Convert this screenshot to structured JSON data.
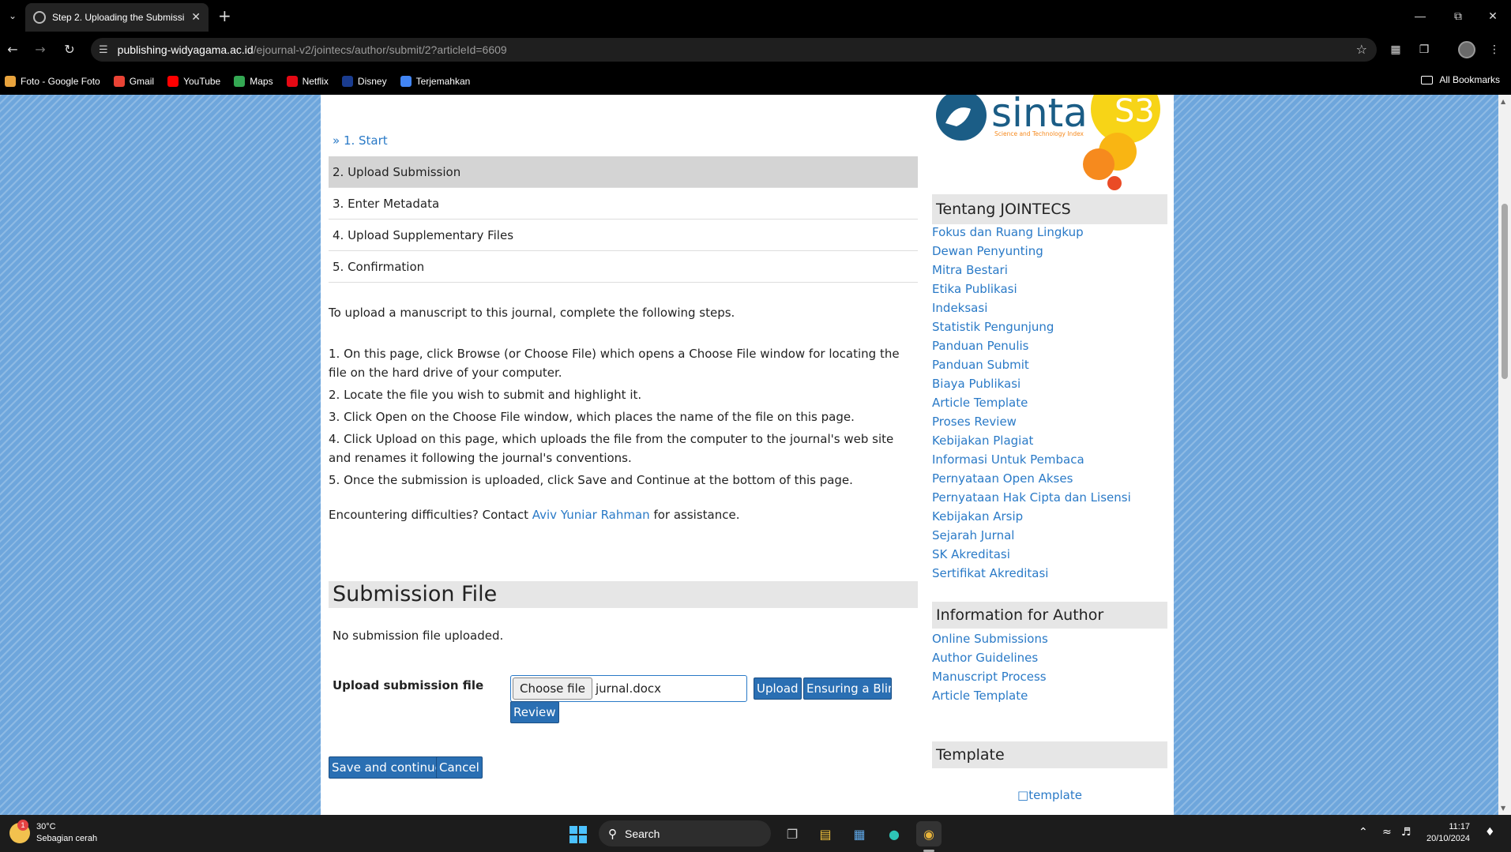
{
  "browser": {
    "tab_title": "Step 2. Uploading the Submissi",
    "url_host": "publishing-widyagama.ac.id",
    "url_path": "/ejournal-v2/jointecs/author/submit/2?articleId=6609",
    "bookmarks": [
      {
        "label": "Foto - Google Foto",
        "icon": "google-photos-icon",
        "color": "#e8a33d"
      },
      {
        "label": "Gmail",
        "icon": "gmail-icon",
        "color": "#ea4335"
      },
      {
        "label": "YouTube",
        "icon": "youtube-icon",
        "color": "#ff0000"
      },
      {
        "label": "Maps",
        "icon": "maps-icon",
        "color": "#34a853"
      },
      {
        "label": "Netflix",
        "icon": "netflix-icon",
        "color": "#e50914"
      },
      {
        "label": "Disney",
        "icon": "disney-icon",
        "color": "#1a3c8f"
      },
      {
        "label": "Terjemahkan",
        "icon": "translate-icon",
        "color": "#4285f4"
      }
    ],
    "all_bookmarks": "All Bookmarks"
  },
  "steps": [
    {
      "label": "» 1. Start",
      "state": "link"
    },
    {
      "label": "2. Upload Submission",
      "state": "active"
    },
    {
      "label": "3. Enter Metadata",
      "state": "normal"
    },
    {
      "label": "4. Upload Supplementary Files",
      "state": "normal"
    },
    {
      "label": "5. Confirmation",
      "state": "normal"
    }
  ],
  "intro": {
    "lead": "To upload a manuscript to this journal, complete the following steps.",
    "items": [
      "1. On this page, click Browse (or Choose File) which opens a Choose File window for locating the file on the hard drive of your computer.",
      "2. Locate the file you wish to submit and highlight it.",
      "3. Click Open on the Choose File window, which places the name of the file on this page.",
      "4. Click Upload on this page, which uploads the file from the computer to the journal's web site and renames it following the journal's conventions.",
      "5. Once the submission is uploaded, click Save and Continue at the bottom of this page."
    ],
    "contact_prefix": "Encountering difficulties? Contact",
    "contact_name": "Aviv Yuniar Rahman",
    "contact_suffix": "for assistance."
  },
  "submission": {
    "heading": "Submission File",
    "status": "No submission file uploaded.",
    "upload_label": "Upload submission file",
    "choose_file": "Choose file",
    "file_name": "jurnal.docx",
    "upload_button": "Upload",
    "blind_review_line1": "Ensuring a Blind",
    "blind_review_line2": "Review",
    "save_button": "Save and continue",
    "cancel_button": "Cancel"
  },
  "sidebar": {
    "sinta_logo_text": "sinta",
    "sinta_tagline": "Science and Technology Index",
    "sinta_badge": "S3",
    "tentang_heading": "Tentang JOINTECS",
    "tentang_links": [
      "Fokus dan Ruang Lingkup",
      "Dewan Penyunting",
      "Mitra Bestari",
      "Etika Publikasi",
      "Indeksasi",
      "Statistik Pengunjung",
      "Panduan Penulis",
      "Panduan Submit",
      "Biaya Publikasi",
      "Article Template",
      "Proses Review",
      "Kebijakan Plagiat",
      "Informasi Untuk Pembaca",
      "Pernyataan Open Akses",
      "Pernyataan Hak Cipta dan Lisensi",
      "Kebijakan Arsip",
      "Sejarah Jurnal",
      "SK Akreditasi",
      "Sertifikat Akreditasi"
    ],
    "author_heading": "Information for Author",
    "author_links": [
      "Online Submissions",
      "Author Guidelines",
      "Manuscript Process",
      "Article Template"
    ],
    "template_heading": "Template",
    "template_alt": "template"
  },
  "taskbar": {
    "temperature": "30°C",
    "weather": "Sebagian cerah",
    "weather_badge": "1",
    "search": "Search",
    "time": "11:17",
    "date": "20/10/2024"
  }
}
